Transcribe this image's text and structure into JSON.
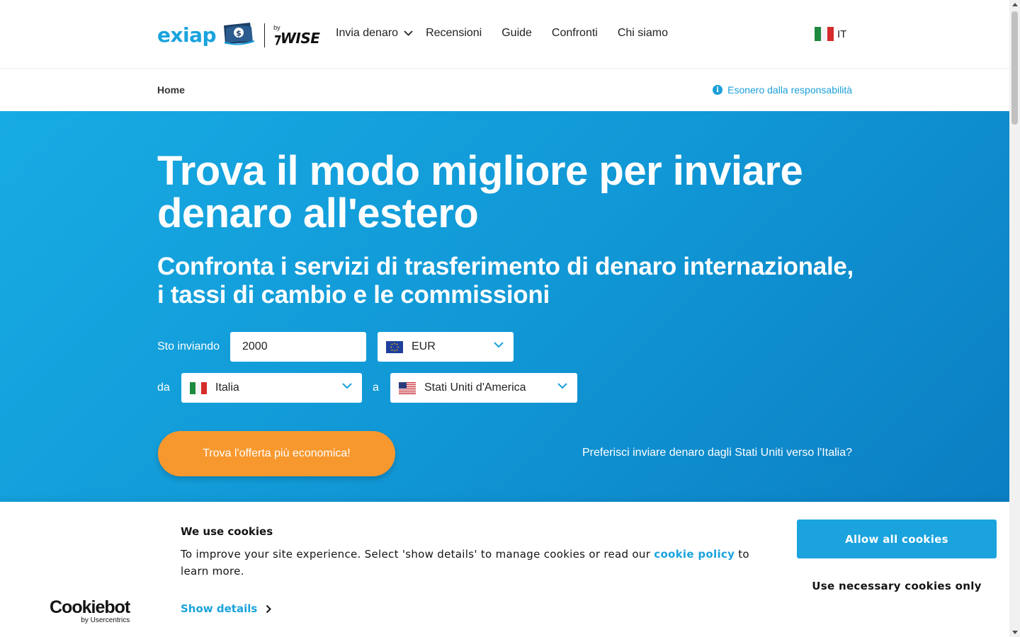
{
  "header": {
    "logo_text": "exiap",
    "by_label": "by",
    "partner": "WISE",
    "nav": [
      {
        "label": "Invia denaro"
      },
      {
        "label": "Recensioni"
      },
      {
        "label": "Guide"
      },
      {
        "label": "Confronti"
      },
      {
        "label": "Chi siamo"
      }
    ],
    "language": "IT"
  },
  "breadcrumb": {
    "home": "Home",
    "disclaimer": "Esonero dalla responsabilità"
  },
  "hero": {
    "title": "Trova il modo migliore per inviare denaro all'estero",
    "subtitle": "Confronta i servizi di trasferimento di denaro internazionale, i tassi di cambio e le commissioni",
    "sending_label": "Sto inviando",
    "amount": "2000",
    "currency": "EUR",
    "from_label": "da",
    "from_country": "Italia",
    "to_label": "a",
    "to_country": "Stati Uniti d'America",
    "cta": "Trova l'offerta più economica!",
    "reverse_link": "Preferisci inviare denaro dagli Stati Uniti verso l'Italia?"
  },
  "cookie_banner": {
    "title": "We use cookies",
    "text_before": "To improve your site experience. Select 'show details' to manage cookies or read our ",
    "policy_link": "cookie policy",
    "text_after": " to learn more.",
    "show_details": "Show details",
    "allow_all": "Allow all cookies",
    "necessary_only": "Use necessary cookies only",
    "brand": "Cookiebot",
    "brand_by": "by Usercentrics"
  },
  "colors": {
    "accent": "#1aa3dd",
    "cta": "#f7982e",
    "hero_bg": "#1198d6"
  },
  "icons": [
    "wallet-icon",
    "chevron-down-icon",
    "italy-flag-icon",
    "eu-flag-icon",
    "us-flag-icon",
    "info-icon",
    "chevron-right-icon"
  ]
}
